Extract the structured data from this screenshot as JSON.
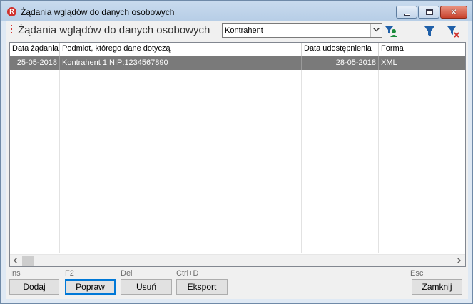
{
  "window": {
    "title": "Żądania wglądów do danych osobowych",
    "app_icon_letter": "R"
  },
  "header": {
    "title": "Żądania wglądów do danych osobowych",
    "filter_combo_value": "Kontrahent"
  },
  "table": {
    "columns": [
      "Data żądania",
      "Podmiot, którego dane dotyczą",
      "Data udostępnienia",
      "Forma"
    ],
    "rows": [
      {
        "request_date": "25-05-2018",
        "subject": "Kontrahent 1 NIP:1234567890",
        "share_date": "28-05-2018",
        "form": "XML"
      }
    ]
  },
  "footer": {
    "buttons": [
      {
        "key": "Ins",
        "label": "Dodaj"
      },
      {
        "key": "F2",
        "label": "Popraw"
      },
      {
        "key": "Del",
        "label": "Usuń"
      },
      {
        "key": "Ctrl+D",
        "label": "Eksport"
      },
      {
        "key": "Esc",
        "label": "Zamknij"
      }
    ]
  },
  "colors": {
    "selected_row": "#7a7a7a",
    "accent_red": "#d0312d",
    "filter_green": "#1a8a3a",
    "filter_blue": "#1f5fa8"
  }
}
